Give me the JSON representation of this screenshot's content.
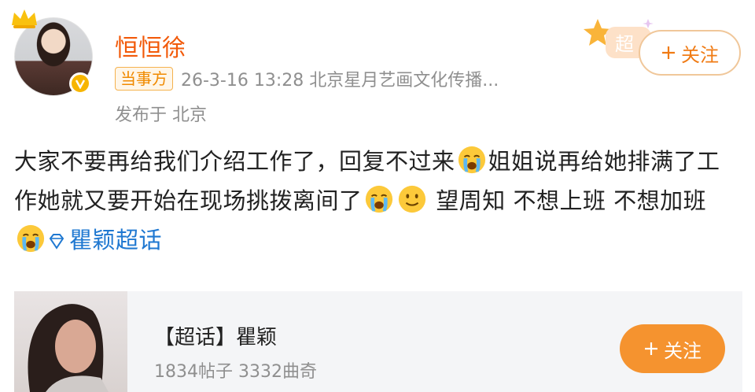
{
  "header": {
    "username": "恒恒徐",
    "tag": "当事方",
    "meta": "26-3-16 13:28  北京星月艺画文化传播...",
    "location": "发布于 北京",
    "super_badge_text": "超",
    "follow_label": "关注"
  },
  "post": {
    "seg1": "大家不要再给我们介绍工作了，回复不过来",
    "seg2": "姐姐说再给她排满了工作她就又要开始在现场挑拨离间了",
    "seg3": " 望周知 不想上班 不想加班",
    "topic": "瞿颖超话",
    "emojis": [
      "crying-emoji",
      "crying-emoji",
      "smile-emoji",
      "crying-emoji"
    ]
  },
  "card": {
    "title": "【超话】瞿颖",
    "stats": "1834帖子 3332曲奇",
    "follow_label": "关注"
  },
  "colors": {
    "username": "#f25a0a",
    "link": "#1f78d1",
    "follow_button": "#f5932f"
  }
}
